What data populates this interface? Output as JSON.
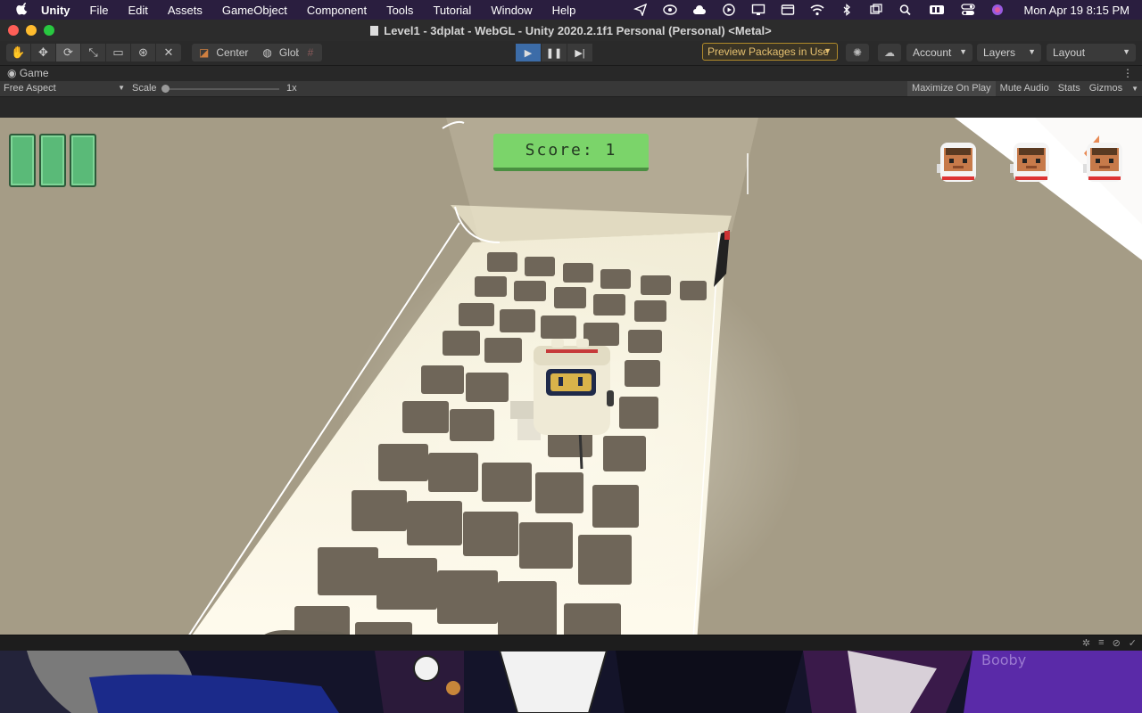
{
  "menubar": {
    "app_name": "Unity",
    "items": [
      "File",
      "Edit",
      "Assets",
      "GameObject",
      "Component",
      "Tools",
      "Tutorial",
      "Window",
      "Help"
    ],
    "clock": "Mon Apr 19  8:15 PM"
  },
  "window": {
    "title": "Level1 - 3dplat - WebGL - Unity 2020.2.1f1 Personal (Personal) <Metal>"
  },
  "toolbar": {
    "pivot_label": "Center",
    "space_label": "Global",
    "preview_packages": "Preview Packages in Use",
    "account": "Account",
    "layers": "Layers",
    "layout": "Layout"
  },
  "game_tab": {
    "label": "Game",
    "aspect": "Free Aspect",
    "scale_label": "Scale",
    "scale_value": "1x",
    "scale_fraction": 0,
    "options": [
      "Maximize On Play",
      "Mute Audio",
      "Stats",
      "Gizmos"
    ]
  },
  "hud": {
    "score_text": "Score: 1",
    "health_cards": 3,
    "lives": 3
  },
  "desktop": {
    "graffiti": "Booby"
  },
  "colors": {
    "menubar": "#2a1e3f",
    "play_active": "#3c6ca8",
    "preview_border": "#b08a2a",
    "score_green": "#7bd46a",
    "card_green": "#5aba78",
    "floor": "#a59c86"
  }
}
